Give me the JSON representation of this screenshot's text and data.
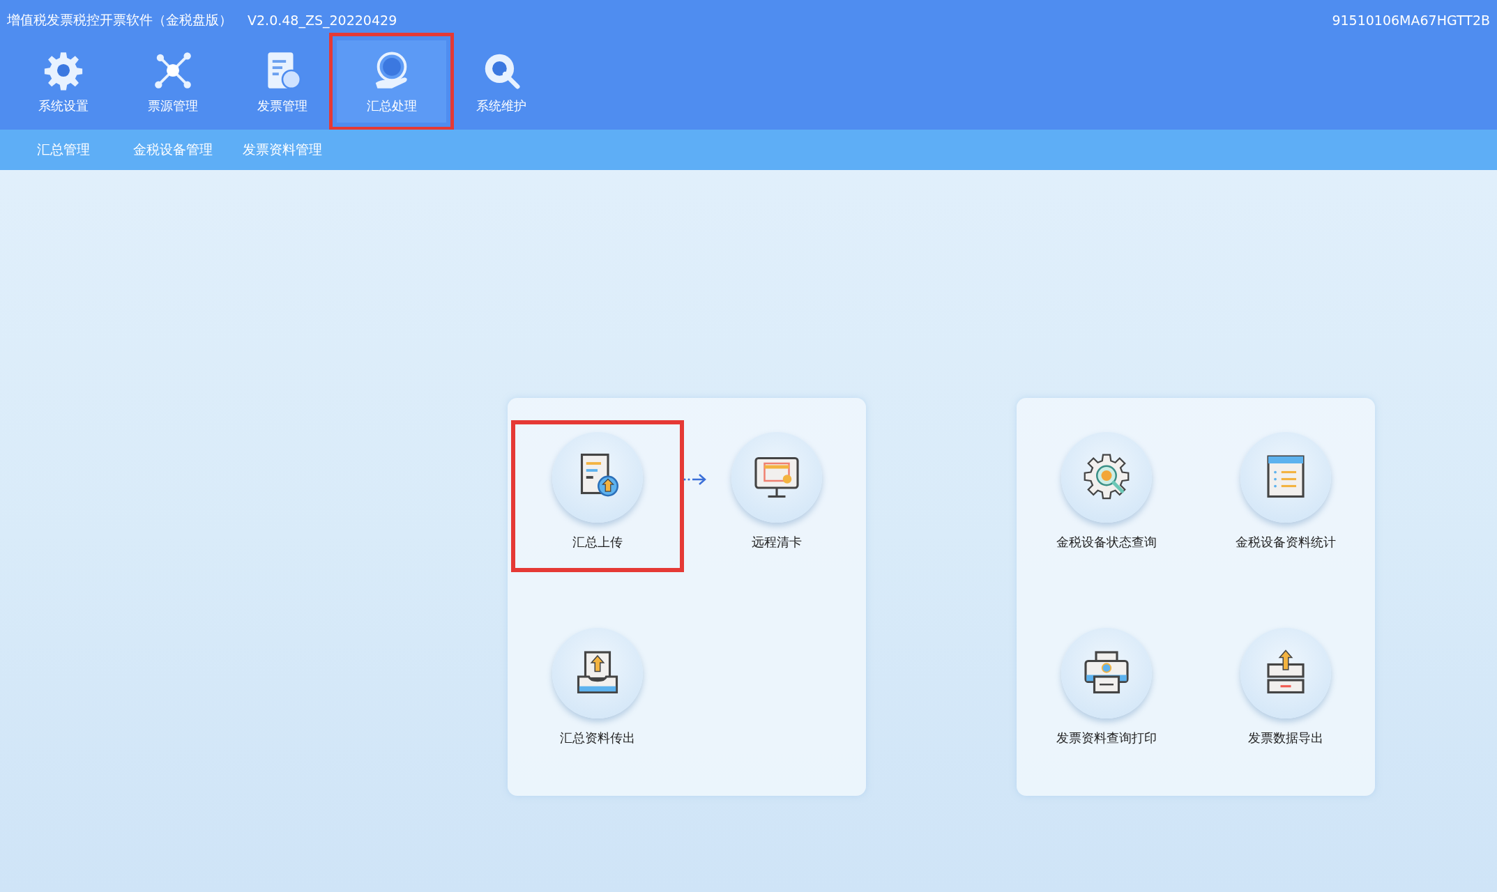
{
  "window": {
    "title": "增值税发票税控开票软件（金税盘版）",
    "version": "V2.0.48_ZS_20220429",
    "tax_id": "91510106MA67HGTT2B"
  },
  "toolbar": [
    {
      "label": "系统设置",
      "selected": false,
      "highlighted": false
    },
    {
      "label": "票源管理",
      "selected": false,
      "highlighted": false
    },
    {
      "label": "发票管理",
      "selected": false,
      "highlighted": false
    },
    {
      "label": "汇总处理",
      "selected": true,
      "highlighted": true
    },
    {
      "label": "系统维护",
      "selected": false,
      "highlighted": false
    }
  ],
  "subnav": [
    "汇总管理",
    "金税设备管理",
    "发票资料管理"
  ],
  "panels": [
    {
      "tiles": [
        {
          "label": "汇总上传",
          "highlighted": true,
          "arrow_after": true
        },
        {
          "label": "远程清卡",
          "highlighted": false,
          "arrow_after": false
        },
        {
          "label": "汇总资料传出",
          "highlighted": false,
          "arrow_after": false
        }
      ]
    },
    {
      "tiles": [
        {
          "label": "金税设备状态查询",
          "highlighted": false,
          "arrow_after": false
        },
        {
          "label": "金税设备资料统计",
          "highlighted": false,
          "arrow_after": false
        },
        {
          "label": "发票资料查询打印",
          "highlighted": false,
          "arrow_after": false
        },
        {
          "label": "发票数据导出",
          "highlighted": false,
          "arrow_after": false
        }
      ]
    }
  ]
}
